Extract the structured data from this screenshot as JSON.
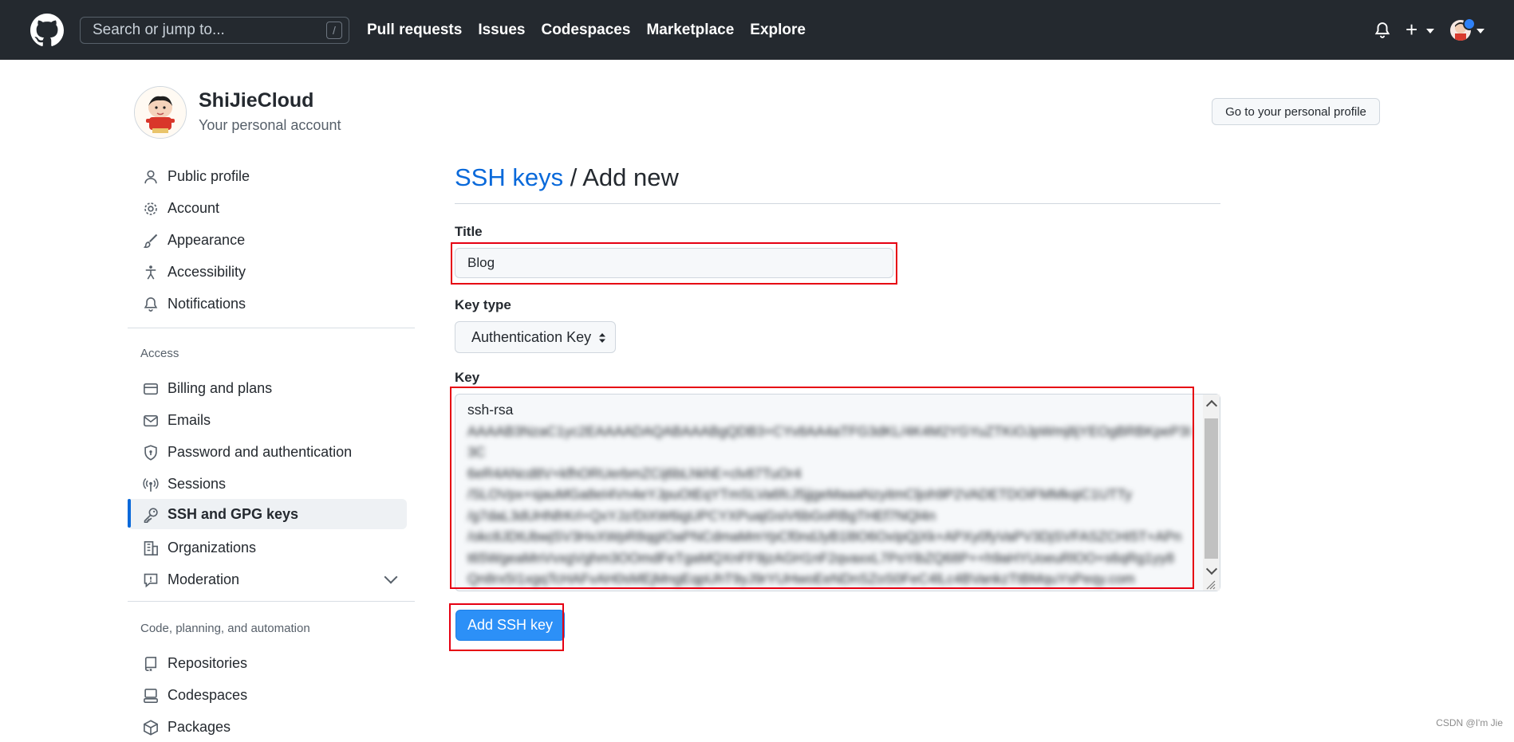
{
  "header": {
    "search_placeholder": "Search or jump to...",
    "search_shortcut": "/",
    "nav": [
      "Pull requests",
      "Issues",
      "Codespaces",
      "Marketplace",
      "Explore"
    ],
    "plus_label": "+"
  },
  "account": {
    "name": "ShiJieCloud",
    "subtitle": "Your personal account",
    "profile_button": "Go to your personal profile"
  },
  "sidebar": {
    "items_top": [
      "Public profile",
      "Account",
      "Appearance",
      "Accessibility",
      "Notifications"
    ],
    "access_heading": "Access",
    "items_access": [
      "Billing and plans",
      "Emails",
      "Password and authentication",
      "Sessions",
      "SSH and GPG keys",
      "Organizations",
      "Moderation"
    ],
    "code_heading": "Code, planning, and automation",
    "items_code": [
      "Repositories",
      "Codespaces",
      "Packages"
    ],
    "active_item": "SSH and GPG keys"
  },
  "main": {
    "breadcrumb_link": "SSH keys",
    "breadcrumb_rest": " / Add new",
    "title_label": "Title",
    "title_value": "Blog",
    "key_type_label": "Key type",
    "key_type_value": "Authentication Key",
    "key_label": "Key",
    "key_line_1": "ssh-rsa",
    "key_line_2": "AAAAB3NzaC1yc2EAAAADAQABAAABgQDB3+CYv8AA4aTFG3dKL/4K4M2YGYuZTKiOJpWmj8jYEOgBRBKpeP3I3C",
    "key_line_3": "6eR4ANcd8V+kfhORUerbmZCij6bLhkhE+clv87TuOr4",
    "key_line_4": "/SLOVpx+sjauMGa8eI4Vn4eYJpuOtEqYTmSLVa6fcJ5jjgeMaaaNzyitmCljoh9P2VADETDOiFMMkqiC1UTTy",
    "key_line_5": "/g7daL3dUHNfrKrl+QxYJz/DiXW6igUPCYXPuajGsiV6bGoRBgTHEf7NQl4n",
    "key_line_6": "/okc8JDtUbwjSV3HxXWpR8qgIOaPNCdmaMmYpCf0ndJyB1l8O6OxIpQjXk+APXy0fyVaPV3DjSVFASZCHI5T+APn",
    "key_line_7": "t65WgeaMnVvxgVghm3OOmdFeTgaMQXnFF9jzAGH1nF2qvaxxL7PoYibZQ68P++h9aHYUoeuRlOO+s6qRg1yy8",
    "key_line_8": "Qn8rx5I1xgqTcHAFvAH0sMEjMngEqpUhT9yJ9rYUHwoEeNDnSZoS0FeC4lLc4BVankzTtBMquYsPeqy.com",
    "add_button": "Add SSH key"
  },
  "watermark": "CSDN @I'm Jie"
}
